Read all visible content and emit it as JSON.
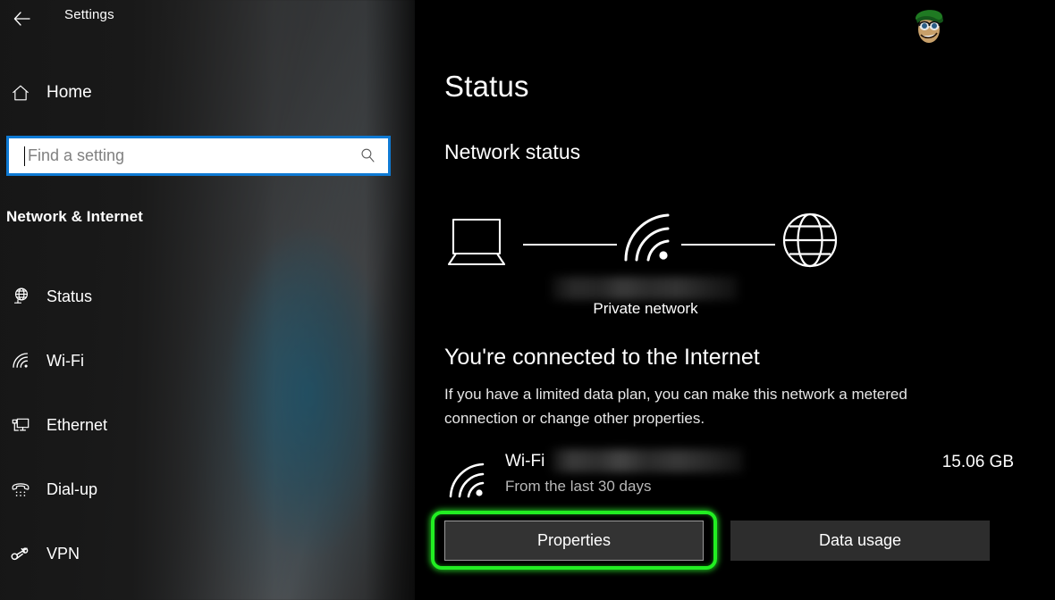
{
  "window": {
    "title": "Settings",
    "back_icon": "back-arrow-icon"
  },
  "sidebar": {
    "home": {
      "label": "Home",
      "icon": "home-icon"
    },
    "search": {
      "placeholder": "Find a setting",
      "value": "",
      "icon": "search-icon"
    },
    "category": "Network & Internet",
    "items": [
      {
        "label": "Status",
        "icon": "network-status-icon",
        "selected": true
      },
      {
        "label": "Wi-Fi",
        "icon": "wifi-icon",
        "selected": false
      },
      {
        "label": "Ethernet",
        "icon": "ethernet-icon",
        "selected": false
      },
      {
        "label": "Dial-up",
        "icon": "dialup-phone-icon",
        "selected": false
      },
      {
        "label": "VPN",
        "icon": "vpn-key-icon",
        "selected": false
      }
    ]
  },
  "main": {
    "page_title": "Status",
    "section_title": "Network status",
    "diagram": {
      "device_icon": "laptop-icon",
      "link_icon": "wifi-signal-icon",
      "internet_icon": "globe-icon",
      "network_name": "",
      "network_name_redacted": true,
      "network_type": "Private network"
    },
    "connection": {
      "headline": "You're connected to the Internet",
      "description": "If you have a limited data plan, you can make this network a metered connection or change other properties."
    },
    "usage": {
      "icon": "wifi-icon",
      "connection_label": "Wi-Fi",
      "ssid": "",
      "ssid_redacted": true,
      "period": "From the last 30 days",
      "amount": "15.06 GB"
    },
    "buttons": {
      "properties": "Properties",
      "data_usage": "Data usage"
    },
    "watermark_icon": "appuals-mascot-logo"
  },
  "colors": {
    "accent_blue": "#0e7ad4",
    "highlight_green": "#22ee22",
    "sidebar_bg": "#2b2b2b",
    "main_bg": "#000000",
    "button_bg": "#2d2d2d"
  }
}
